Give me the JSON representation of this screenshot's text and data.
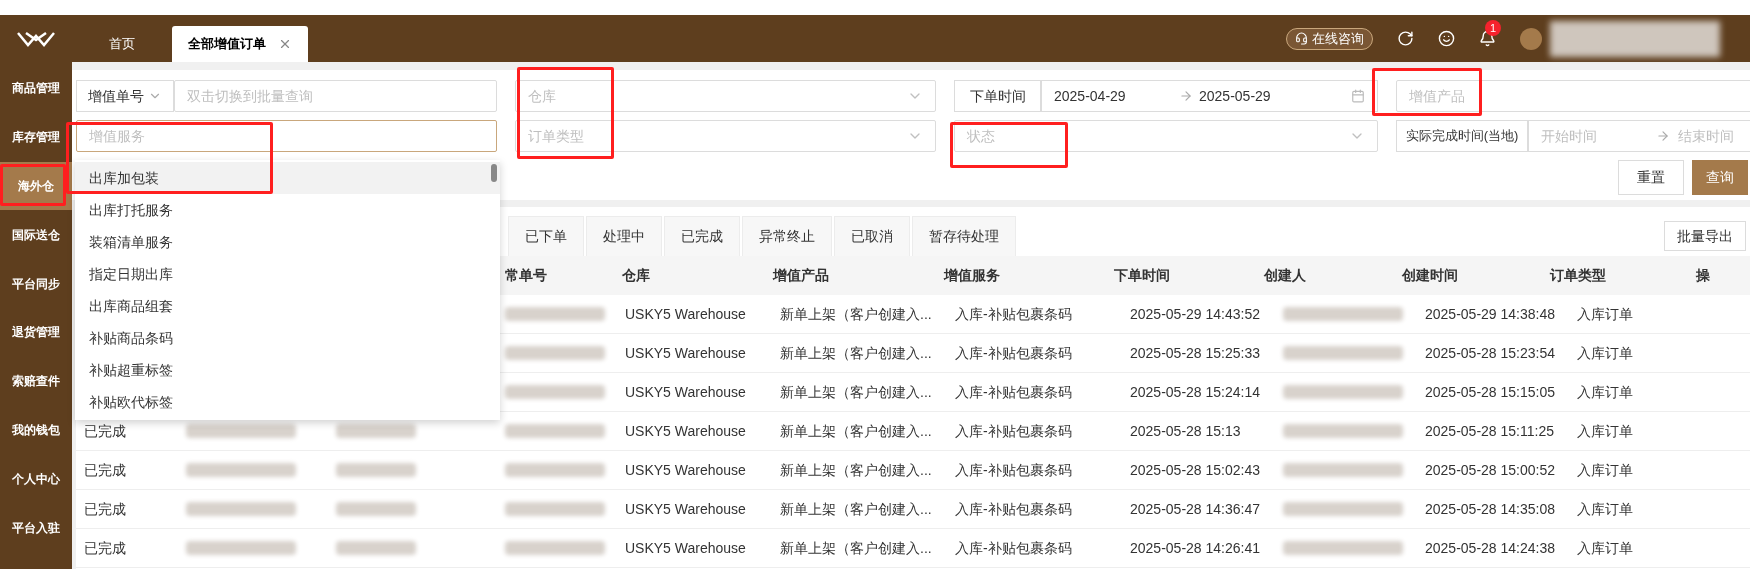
{
  "header": {
    "tabs": [
      {
        "label": "首页",
        "selected": false,
        "closable": false
      },
      {
        "label": "全部增值订单",
        "selected": true,
        "closable": true
      }
    ],
    "consult_button": "在线咨询",
    "notification_count": "1"
  },
  "sidebar": {
    "items": [
      {
        "label": "商品管理",
        "selected": false
      },
      {
        "label": "库存管理",
        "selected": false
      },
      {
        "label": "海外仓",
        "selected": true
      },
      {
        "label": "国际送仓",
        "selected": false
      },
      {
        "label": "平台同步",
        "selected": false
      },
      {
        "label": "退货管理",
        "selected": false
      },
      {
        "label": "索赔查件",
        "selected": false
      },
      {
        "label": "我的钱包",
        "selected": false
      },
      {
        "label": "个人中心",
        "selected": false
      },
      {
        "label": "平台入驻",
        "selected": false
      }
    ]
  },
  "filters": {
    "number_type": "增值单号",
    "batch_placeholder": "双击切换到批量查询",
    "warehouse_placeholder": "仓库",
    "order_time_label": "下单时间",
    "date_from": "2025-04-29",
    "date_to": "2025-05-29",
    "product_placeholder": "增值产品",
    "service_placeholder": "增值服务",
    "order_type_placeholder": "订单类型",
    "status_placeholder": "状态",
    "completion_label": "实际完成时间(当地)",
    "start_placeholder": "开始时间",
    "end_placeholder": "结束时间",
    "reset_button": "重置",
    "search_button": "查询"
  },
  "service_dropdown": {
    "items": [
      {
        "label": "出库加包装",
        "selected": true
      },
      {
        "label": "出库打托服务",
        "selected": false
      },
      {
        "label": "装箱清单服务",
        "selected": false
      },
      {
        "label": "指定日期出库",
        "selected": false
      },
      {
        "label": "出库商品组套",
        "selected": false
      },
      {
        "label": "补贴商品条码",
        "selected": false
      },
      {
        "label": "补贴超重标签",
        "selected": false
      },
      {
        "label": "补贴欧代标签",
        "selected": false
      }
    ]
  },
  "status_tabs": [
    {
      "label": "已下单",
      "selected": false
    },
    {
      "label": "处理中",
      "selected": false
    },
    {
      "label": "已完成",
      "selected": false
    },
    {
      "label": "异常终止",
      "selected": false
    },
    {
      "label": "已取消",
      "selected": false
    },
    {
      "label": "暂存待处理",
      "selected": false
    }
  ],
  "export_button": "批量导出",
  "table": {
    "columns": [
      "常单号",
      "仓库",
      "增值产品",
      "增值服务",
      "下单时间",
      "创建人",
      "创建时间",
      "订单类型",
      "操"
    ],
    "rows": [
      {
        "warehouse": "USKY5 Warehouse",
        "product": "新单上架（客户创建入...",
        "service": "入库-补贴包裹条码",
        "order_time": "2025-05-29 14:43:52",
        "created_time": "2025-05-29 14:38:48",
        "order_type": "入库订单"
      },
      {
        "warehouse": "USKY5 Warehouse",
        "product": "新单上架（客户创建入...",
        "service": "入库-补贴包裹条码",
        "order_time": "2025-05-28 15:25:33",
        "created_time": "2025-05-28 15:23:54",
        "order_type": "入库订单"
      },
      {
        "warehouse": "USKY5 Warehouse",
        "product": "新单上架（客户创建入...",
        "service": "入库-补贴包裹条码",
        "order_time": "2025-05-28 15:24:14",
        "created_time": "2025-05-28 15:15:05",
        "order_type": "入库订单"
      },
      {
        "status": "已完成",
        "warehouse": "USKY5 Warehouse",
        "product": "新单上架（客户创建入...",
        "service": "入库-补贴包裹条码",
        "order_time": "2025-05-28 15:13",
        "created_time": "2025-05-28 15:11:25",
        "order_type": "入库订单"
      },
      {
        "status": "已完成",
        "warehouse": "USKY5 Warehouse",
        "product": "新单上架（客户创建入...",
        "service": "入库-补贴包裹条码",
        "order_time": "2025-05-28 15:02:43",
        "created_time": "2025-05-28 15:00:52",
        "order_type": "入库订单"
      },
      {
        "status": "已完成",
        "warehouse": "USKY5 Warehouse",
        "product": "新单上架（客户创建入...",
        "service": "入库-补贴包裹条码",
        "order_time": "2025-05-28 14:36:47",
        "created_time": "2025-05-28 14:35:08",
        "order_type": "入库订单"
      },
      {
        "status": "已完成",
        "warehouse": "USKY5 Warehouse",
        "product": "新单上架（客户创建入...",
        "service": "入库-补贴包裹条码",
        "order_time": "2025-05-28 14:26:41",
        "created_time": "2025-05-28 14:24:38",
        "order_type": "入库订单"
      }
    ]
  }
}
